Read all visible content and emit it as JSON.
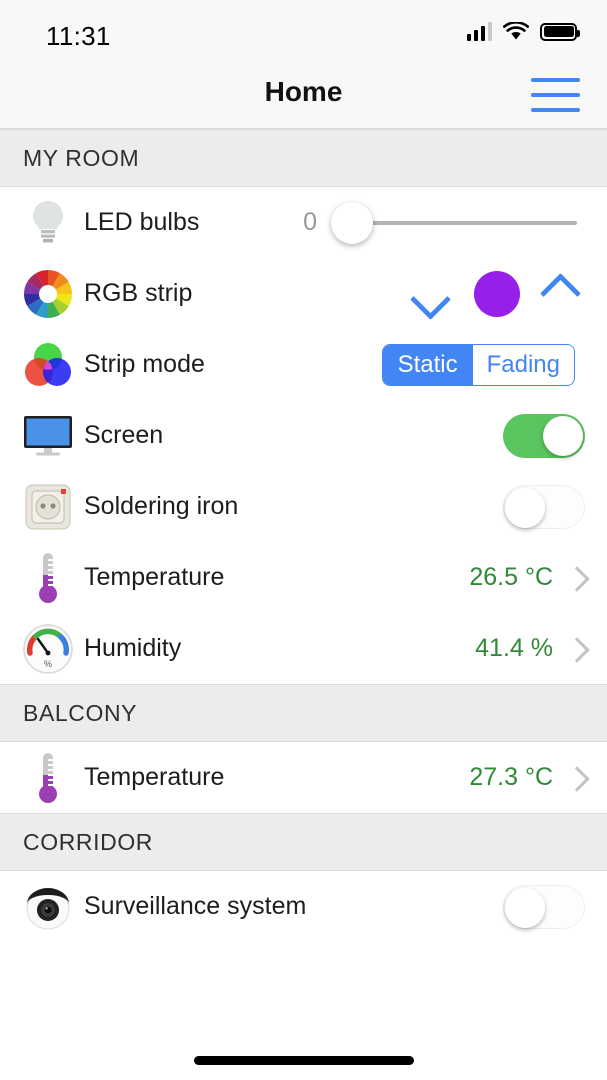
{
  "status_bar": {
    "time": "11:31",
    "signal_icon": "cellular-signal-icon",
    "wifi_icon": "wifi-icon",
    "battery_icon": "battery-full-icon"
  },
  "nav": {
    "title": "Home",
    "menu_icon": "hamburger-menu-icon"
  },
  "colors": {
    "accent_blue": "#4285f4",
    "toggle_on_green": "#5ac45f",
    "sensor_green": "#2f8a36",
    "rgb_color": "#9620e8",
    "section_bg": "#ececed"
  },
  "sections": [
    {
      "title": "MY ROOM",
      "rows": [
        {
          "label": "LED bulbs",
          "icon": "light-bulb-icon",
          "control": "slider",
          "value": "0"
        },
        {
          "label": "RGB strip",
          "icon": "color-wheel-icon",
          "control": "color-stepper",
          "color": "#9620e8",
          "down_icon": "chevron-down-icon",
          "up_icon": "chevron-up-icon"
        },
        {
          "label": "Strip mode",
          "icon": "rgb-circles-icon",
          "control": "segmented",
          "options": [
            "Static",
            "Fading"
          ],
          "selected": "Static"
        },
        {
          "label": "Screen",
          "icon": "monitor-icon",
          "control": "toggle",
          "state": "on"
        },
        {
          "label": "Soldering iron",
          "icon": "power-socket-icon",
          "control": "toggle",
          "state": "off"
        },
        {
          "label": "Temperature",
          "icon": "thermometer-icon",
          "control": "sensor",
          "value": "26.5 °C",
          "disclosure_icon": "chevron-right-icon"
        },
        {
          "label": "Humidity",
          "icon": "hygrometer-icon",
          "control": "sensor",
          "value": "41.4 %",
          "disclosure_icon": "chevron-right-icon"
        }
      ]
    },
    {
      "title": "BALCONY",
      "rows": [
        {
          "label": "Temperature",
          "icon": "thermometer-icon",
          "control": "sensor",
          "value": "27.3 °C",
          "disclosure_icon": "chevron-right-icon"
        }
      ]
    },
    {
      "title": "CORRIDOR",
      "rows": [
        {
          "label": "Surveillance system",
          "icon": "security-camera-icon",
          "control": "toggle",
          "state": "off"
        }
      ]
    }
  ]
}
